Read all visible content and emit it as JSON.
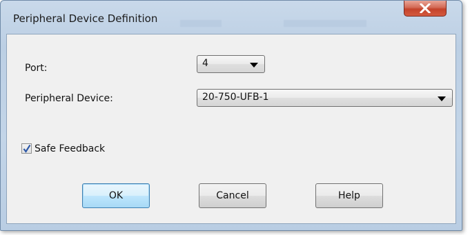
{
  "window": {
    "title": "Peripheral Device Definition",
    "close_icon": "close-x-icon"
  },
  "form": {
    "port_label": "Port:",
    "port_value": "4",
    "device_label": "Peripheral Device:",
    "device_value": "20-750-UFB-1",
    "safe_feedback_label": "Safe Feedback",
    "safe_feedback_checked": true
  },
  "buttons": {
    "ok": "OK",
    "cancel": "Cancel",
    "help": "Help"
  },
  "colors": {
    "close_button": "#c4432b",
    "default_button_border": "#3c7fb1"
  }
}
